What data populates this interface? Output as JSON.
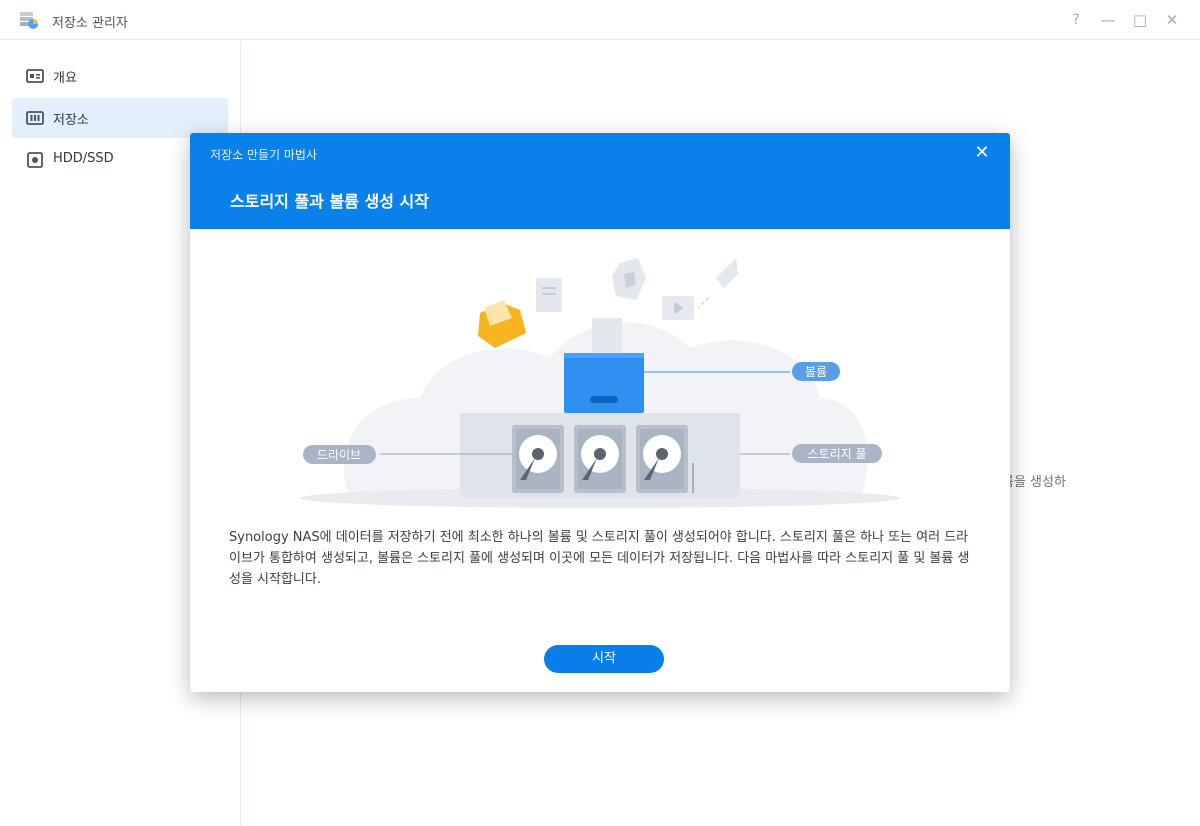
{
  "window": {
    "title": "저장소 관리자",
    "controls": {
      "help": "?",
      "minimize": "—",
      "maximize": "□",
      "close": "✕"
    }
  },
  "sidebar": {
    "items": [
      {
        "label": "개요",
        "icon": "overview-icon",
        "active": false
      },
      {
        "label": "저장소",
        "icon": "storage-icon",
        "active": true
      },
      {
        "label": "HDD/SSD",
        "icon": "hdd-icon",
        "active": false
      }
    ]
  },
  "background": {
    "partial_text": "륨을 생성하"
  },
  "wizard": {
    "caption": "저장소 만들기 마법사",
    "close": "✕",
    "heading": "스토리지 풀과 볼륨 생성 시작",
    "illustration": {
      "label_volume": "볼륨",
      "label_drive": "드라이브",
      "label_pool": "스토리지 풀"
    },
    "description": "Synology NAS에 데이터를 저장하기 전에 최소한 하나의 볼륨 및 스토리지 풀이 생성되어야 합니다. 스토리지 풀은 하나 또는 여러 드라이브가 통합하여 생성되고, 볼륨은 스토리지 풀에 생성되며 이곳에 모든 데이터가 저장됩니다. 다음 마법사를 따라 스토리지 풀 및 볼륨 생성을 시작합니다.",
    "start_button": "시작"
  },
  "colors": {
    "accent": "#0a80ea",
    "active_nav": "#e3effc",
    "label_pill": "#a9b4c7"
  }
}
